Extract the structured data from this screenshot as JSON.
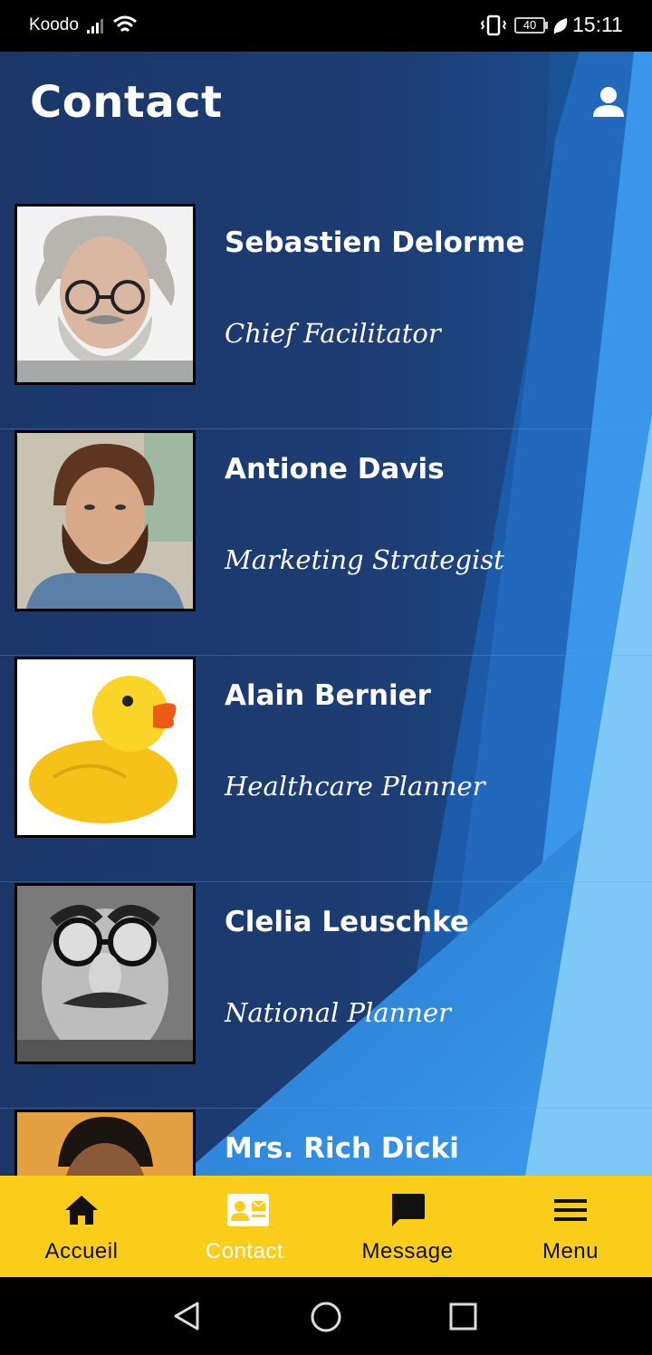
{
  "status_bar": {
    "carrier": "Koodo",
    "battery": "40",
    "time": "15:11"
  },
  "header": {
    "title": "Contact",
    "icon": "user-icon"
  },
  "contacts": [
    {
      "name": "Sebastien Delorme",
      "role": "Chief Facilitator"
    },
    {
      "name": "Antione Davis",
      "role": "Marketing Strategist"
    },
    {
      "name": "Alain Bernier",
      "role": "Healthcare Planner"
    },
    {
      "name": "Clelia Leuschke",
      "role": "National Planner"
    },
    {
      "name": "Mrs. Rich Dicki",
      "role": ""
    }
  ],
  "bottom_nav": {
    "items": [
      {
        "label": "Accueil",
        "icon": "home-icon"
      },
      {
        "label": "Contact",
        "icon": "contact-card-icon",
        "active": true
      },
      {
        "label": "Message",
        "icon": "message-icon"
      },
      {
        "label": "Menu",
        "icon": "menu-icon"
      }
    ]
  },
  "colors": {
    "accent": "#fbcd1b",
    "background": "#1c3a6c",
    "highlight": "#7ec8f8"
  }
}
